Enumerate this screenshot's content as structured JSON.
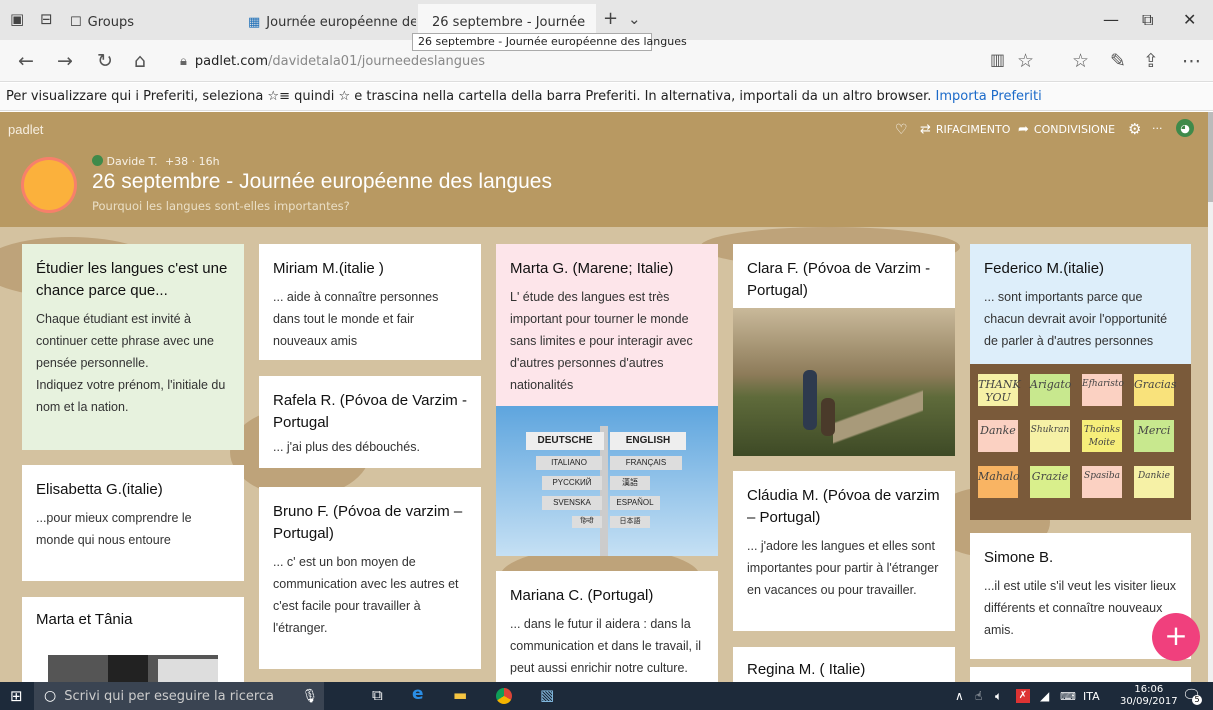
{
  "browser": {
    "tabs": [
      {
        "label": "Groups"
      },
      {
        "label": "Journée européenne des lar"
      },
      {
        "label": "26 septembre - Journée"
      }
    ],
    "tooltip": "26 septembre - Journée européenne des langues",
    "url_domain": "padlet.com",
    "url_path": "/davidetala01/journeedeslangues",
    "favorites_text": "Per visualizzare qui i Preferiti, seleziona ☆≡ quindi ☆ e trascina nella cartella della barra Preferiti. In alternativa, importali da un altro browser.",
    "favorites_link": "Importa Preferiti"
  },
  "padlet": {
    "logo": "padlet",
    "remake": "RIFACIMENTO",
    "share": "CONDIVISIONE",
    "author": "Davide T.",
    "karma": "+38",
    "time": "16h",
    "title": "26 septembre - Journée européenne des langues",
    "subtitle": "Pourquoi les langues sont-elles importantes?"
  },
  "cards": {
    "c1": {
      "title": "Étudier les langues c'est une chance parce que...",
      "body": "Chaque étudiant est invité à continuer cette phrase avec une pensée personnelle.\nIndiquez votre prénom, l'initiale du nom et la nation."
    },
    "c2": {
      "title": "Elisabetta G.(italie)",
      "body": "...pour mieux comprendre le monde qui nous entoure"
    },
    "c3": {
      "title": "Marta et Tânia"
    },
    "c4": {
      "title": "Miriam M.(italie )",
      "body": "... aide à connaître personnes dans tout le monde  et fair nouveaux amis"
    },
    "c5": {
      "title": "Rafela R. (Póvoa de Varzim - Portugal",
      "body": "... j'ai plus des débouchés."
    },
    "c6": {
      "title": "Bruno F. (Póvoa de varzim – Portugal)",
      "body": "... c' est un bon moyen de communication avec les autres et c'est facile pour travailler à l'étranger."
    },
    "c7": {
      "title": "Marta G. (Marene; Italie)",
      "body": "L' étude des langues est très important pour tourner le monde sans limites e pour interagir avec d'autres personnes d'autres nationalités"
    },
    "c8": {
      "title": "Mariana C. (Portugal)",
      "body": "... dans le futur il aidera : dans la communication et dans le travail, il peut aussi enrichir notre culture."
    },
    "c9": {
      "title": "Clara F. (Póvoa de Varzim - Portugal)"
    },
    "c10": {
      "title": "Cláudia M. (Póvoa de varzim – Portugal)",
      "body": "... j'adore les langues et elles sont importantes pour partir à l'étranger en vacances ou pour travailler."
    },
    "c11": {
      "title": "Regina M. ( Italie)"
    },
    "c12": {
      "title": "Federico M.(italie)",
      "body": "... sont importants parce que chacun devrait avoir l'opportunité de parler à d'autres personnes"
    },
    "c13": {
      "title": "Simone B.",
      "body": "...il est utile s'il veut les visiter lieux différents et connaître nouveaux amis."
    }
  },
  "signpost": [
    "DEUTSCHE",
    "ENGLISH",
    "ITALIANO",
    "FRANÇAIS",
    "PYCCKИЙ",
    "漢語",
    "SVENSKA",
    "ESPAÑOL",
    "日本語",
    "हिन्दी"
  ],
  "thanks_notes": [
    "THANK YOU",
    "Arigato",
    "Efharisto",
    "Gracias",
    "Danke",
    "Shukran",
    "Thoinks Moite",
    "Merci",
    "Mahalo",
    "Grazie",
    "Spasiba",
    "Dankie"
  ],
  "taskbar": {
    "search_placeholder": "Scrivi qui per eseguire la ricerca",
    "lang": "ITA",
    "time": "16:06",
    "date": "30/09/2017",
    "notif_count": "5"
  }
}
